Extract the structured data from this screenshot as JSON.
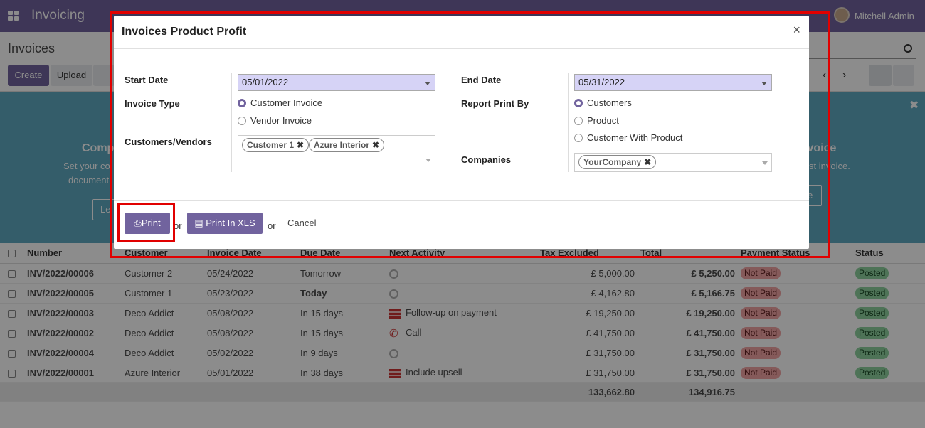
{
  "nav": {
    "app_name": "Invoicing",
    "user_name": "Mitchell Admin"
  },
  "control_panel": {
    "title": "Invoices",
    "create_label": "Create",
    "upload_label": "Upload"
  },
  "banner": {
    "left_title": "Comp",
    "left_text_1": "Set your co",
    "left_text_2": "document",
    "left_button": "Le",
    "right_title": "ivoice",
    "right_text": "st invoice.",
    "right_button": "e"
  },
  "table": {
    "columns": [
      "Number",
      "Customer",
      "Invoice Date",
      "Due Date",
      "Next Activity",
      "Tax Excluded",
      "Total",
      "Payment Status",
      "Status"
    ],
    "rows": [
      {
        "number": "INV/2022/00006",
        "customer": "Customer 2",
        "invoice_date": "05/24/2022",
        "due_date": "Tomorrow",
        "activity": "",
        "tax_excluded": "£ 5,000.00",
        "total": "£ 5,250.00",
        "payment_status": "Not Paid",
        "status": "Posted"
      },
      {
        "number": "INV/2022/00005",
        "customer": "Customer 1",
        "invoice_date": "05/23/2022",
        "due_date": "Today",
        "activity": "",
        "tax_excluded": "£ 4,162.80",
        "total": "£ 5,166.75",
        "payment_status": "Not Paid",
        "status": "Posted"
      },
      {
        "number": "INV/2022/00003",
        "customer": "Deco Addict",
        "invoice_date": "05/08/2022",
        "due_date": "In 15 days",
        "activity": "Follow-up on payment",
        "tax_excluded": "£ 19,250.00",
        "total": "£ 19,250.00",
        "payment_status": "Not Paid",
        "status": "Posted"
      },
      {
        "number": "INV/2022/00002",
        "customer": "Deco Addict",
        "invoice_date": "05/08/2022",
        "due_date": "In 15 days",
        "activity": "Call",
        "tax_excluded": "£ 41,750.00",
        "total": "£ 41,750.00",
        "payment_status": "Not Paid",
        "status": "Posted"
      },
      {
        "number": "INV/2022/00004",
        "customer": "Deco Addict",
        "invoice_date": "05/02/2022",
        "due_date": "In 9 days",
        "activity": "",
        "tax_excluded": "£ 31,750.00",
        "total": "£ 31,750.00",
        "payment_status": "Not Paid",
        "status": "Posted"
      },
      {
        "number": "INV/2022/00001",
        "customer": "Azure Interior",
        "invoice_date": "05/01/2022",
        "due_date": "In 38 days",
        "activity": "Include upsell",
        "tax_excluded": "£ 31,750.00",
        "total": "£ 31,750.00",
        "payment_status": "Not Paid",
        "status": "Posted"
      }
    ],
    "sum_tax_excluded": "133,662.80",
    "sum_total": "134,916.75"
  },
  "modal": {
    "title": "Invoices Product Profit",
    "close": "×",
    "start_date_label": "Start Date",
    "start_date": "05/01/2022",
    "end_date_label": "End Date",
    "end_date": "05/31/2022",
    "invoice_type_label": "Invoice Type",
    "invoice_type_options": [
      "Customer Invoice",
      "Vendor Invoice"
    ],
    "report_print_by_label": "Report Print By",
    "report_print_by_options": [
      "Customers",
      "Product",
      "Customer With Product"
    ],
    "customers_vendors_label": "Customers/Vendors",
    "customers_vendors_tags": [
      "Customer 1",
      "Azure Interior"
    ],
    "companies_label": "Companies",
    "companies_tags": [
      "YourCompany"
    ],
    "print_label": "Print",
    "print_xls_label": "Print In XLS",
    "or_label": "or",
    "cancel_label": "Cancel"
  },
  "colors": {
    "brand": "#71639e",
    "highlight": "#e10000",
    "date_field": "#d6d3f6"
  }
}
